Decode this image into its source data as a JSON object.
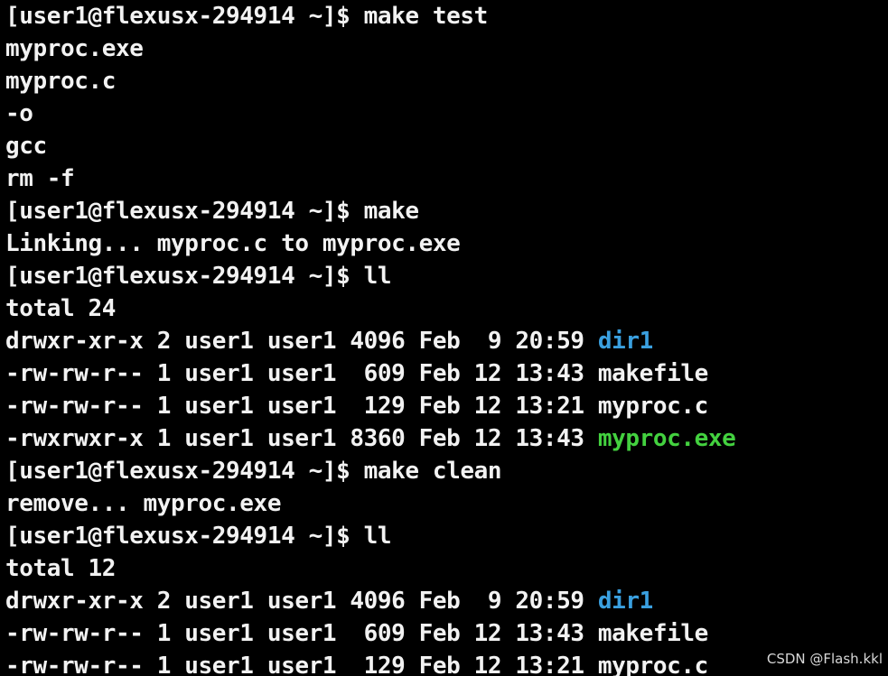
{
  "terminal": {
    "colors": {
      "background": "#000000",
      "text": "#f2f2f2",
      "directory": "#3aa0e0",
      "executable": "#43d13f"
    },
    "lines": [
      {
        "text": "[user1@flexusx-294914 ~]$ make test"
      },
      {
        "text": "myproc.exe"
      },
      {
        "text": "myproc.c"
      },
      {
        "text": "-o"
      },
      {
        "text": "gcc"
      },
      {
        "text": "rm -f"
      },
      {
        "text": "[user1@flexusx-294914 ~]$ make"
      },
      {
        "text": "Linking... myproc.c to myproc.exe"
      },
      {
        "text": "[user1@flexusx-294914 ~]$ ll"
      },
      {
        "text": "total 24"
      },
      {
        "text": "drwxr-xr-x 2 user1 user1 4096 Feb  9 20:59 ",
        "name": "dir1",
        "kind": "dir"
      },
      {
        "text": "-rw-rw-r-- 1 user1 user1  609 Feb 12 13:43 ",
        "name": "makefile",
        "kind": "file"
      },
      {
        "text": "-rw-rw-r-- 1 user1 user1  129 Feb 12 13:21 ",
        "name": "myproc.c",
        "kind": "file"
      },
      {
        "text": "-rwxrwxr-x 1 user1 user1 8360 Feb 12 13:43 ",
        "name": "myproc.exe",
        "kind": "exe"
      },
      {
        "text": "[user1@flexusx-294914 ~]$ make clean"
      },
      {
        "text": "remove... myproc.exe"
      },
      {
        "text": "[user1@flexusx-294914 ~]$ ll"
      },
      {
        "text": "total 12"
      },
      {
        "text": "drwxr-xr-x 2 user1 user1 4096 Feb  9 20:59 ",
        "name": "dir1",
        "kind": "dir"
      },
      {
        "text": "-rw-rw-r-- 1 user1 user1  609 Feb 12 13:43 ",
        "name": "makefile",
        "kind": "file"
      },
      {
        "text": "-rw-rw-r-- 1 user1 user1  129 Feb 12 13:21 ",
        "name": "myproc.c",
        "kind": "file"
      }
    ]
  },
  "watermark": "CSDN @Flash.kkl"
}
